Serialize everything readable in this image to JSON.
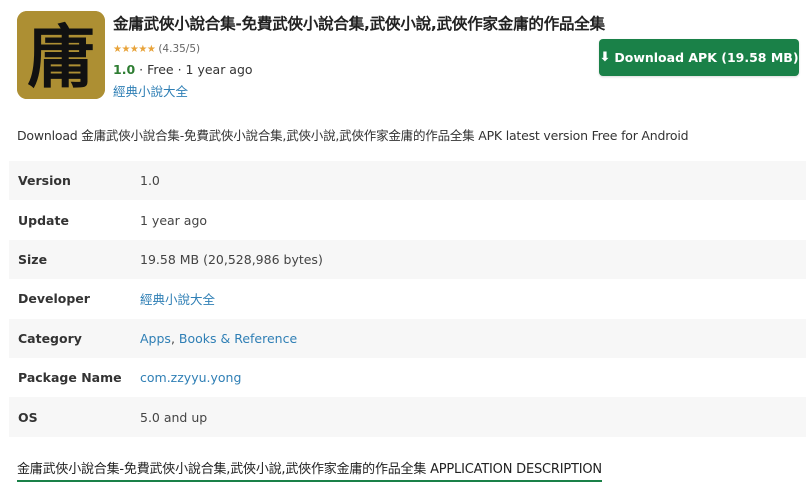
{
  "app": {
    "title": "金庸武俠小說合集-免費武俠小說合集,武俠小說,武俠作家金庸的作品全集",
    "icon_glyph": "庸",
    "icon_bg_color": "#ad8f33",
    "stars": "★★★★★",
    "rating": "(4.35/5)",
    "version": "1.0",
    "meta_rest": " · Free · 1 year ago",
    "developer": "經典小說大全"
  },
  "download": {
    "icon": "download-arrow-icon",
    "label": "Download APK (19.58 MB)",
    "color": "#1a8148"
  },
  "intro_text": "Download 金庸武俠小說合集-免費武俠小說合集,武俠小說,武俠作家金庸的作品全集 APK latest version Free for Android",
  "info": {
    "version": {
      "label": "Version",
      "value": "1.0"
    },
    "update": {
      "label": "Update",
      "value": "1 year ago"
    },
    "size": {
      "label": "Size",
      "value": "19.58 MB (20,528,986 bytes)"
    },
    "developer": {
      "label": "Developer",
      "value": "經典小說大全"
    },
    "category": {
      "label": "Category",
      "value1": "Apps",
      "sep": ", ",
      "value2": "Books & Reference"
    },
    "package": {
      "label": "Package Name",
      "value": "com.zzyyu.yong"
    },
    "os": {
      "label": "OS",
      "value": "5.0 and up"
    }
  },
  "description_heading": "金庸武俠小說合集-免費武俠小說合集,武俠小說,武俠作家金庸的作品全集 APPLICATION DESCRIPTION"
}
